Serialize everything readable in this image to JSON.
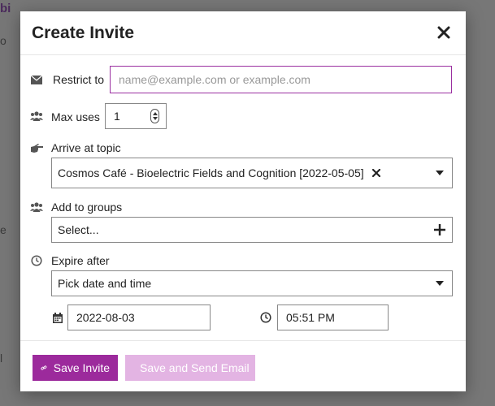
{
  "dialog": {
    "title": "Create Invite"
  },
  "restrict_to": {
    "label": "Restrict to",
    "placeholder": "name@example.com or example.com",
    "value": ""
  },
  "max_uses": {
    "label": "Max uses",
    "value": "1"
  },
  "arrive_at_topic": {
    "label": "Arrive at topic",
    "selected": "Cosmos Café - Bioelectric Fields and Cognition [2022-05-05]"
  },
  "add_to_groups": {
    "label": "Add to groups",
    "placeholder": "Select..."
  },
  "expire_after": {
    "label": "Expire after",
    "selected": "Pick date and time",
    "date": "2022-08-03",
    "time": "05:51 PM"
  },
  "buttons": {
    "save_invite": "Save Invite",
    "save_and_send": "Save and Send Email"
  },
  "colors": {
    "accent": "#9c2a9c",
    "accent_disabled": "#e3b4e3",
    "focus_border": "#9a2fa0"
  },
  "icons": {
    "close": "close-icon",
    "envelope": "envelope-icon",
    "users": "users-icon",
    "hand": "hand-pointing-icon",
    "clock": "clock-icon",
    "calendar": "calendar-icon",
    "plus": "plus-icon",
    "link": "link-icon"
  }
}
